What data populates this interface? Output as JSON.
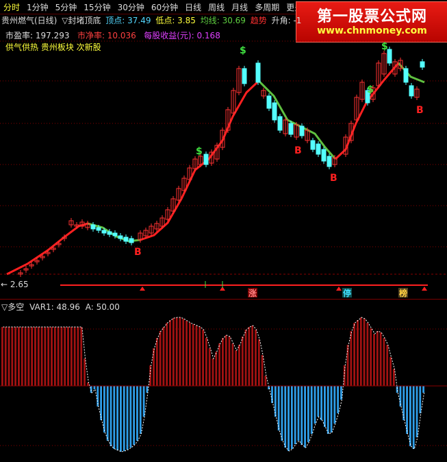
{
  "toolbar": {
    "periods": [
      "分时",
      "1分钟",
      "5分钟",
      "15分钟",
      "30分钟",
      "60分钟",
      "日线",
      "周线",
      "月线",
      "多周期",
      "更多"
    ],
    "active_index": 0
  },
  "logo": {
    "main": "第一股票公式网",
    "sub": "www.chnmoney.com"
  },
  "info": {
    "stock": "贵州燃气(日线)",
    "formula": "▽封堵顶底",
    "high_label": "顶点: 37.49",
    "low_label": "低点: 3.85",
    "avg_label": "均线: 30.69",
    "trend_label": "趋势",
    "angle_label": "升角: -1"
  },
  "fundamentals": {
    "pe": "市盈率:  197.293",
    "pb": "市净率:  10.036",
    "eps": "每股收益(元):  0.168"
  },
  "tags": "供气供热 贵州板块 次新股",
  "price_low_marker": "2.65",
  "markers": {
    "buy": "$",
    "sell": "B",
    "limit_up": "涨",
    "halt": "停",
    "list": "榜"
  },
  "lower_panel": {
    "title": "▽多空",
    "var1": "VAR1: 48.96",
    "a_val": "A: 50.00"
  },
  "colors": {
    "up_candle": "#ff3232",
    "down_candle": "#54ffff",
    "trend_up": "#ff2020",
    "trend_down": "#5fc040",
    "bull_bar": "#a31212",
    "bear_bar": "#2f9ee8",
    "accent": "#ffff3b"
  },
  "chart_data": {
    "type": "bar",
    "title": "",
    "bull_bear_values": [
      86,
      86,
      86,
      86,
      86,
      86,
      86,
      86,
      86,
      86,
      86,
      86,
      86,
      86,
      86,
      86,
      86,
      86,
      86,
      86,
      86,
      86,
      86,
      86,
      86,
      40,
      5,
      -10,
      -5,
      -30,
      -50,
      -68,
      -80,
      -88,
      -92,
      -94,
      -96,
      -95,
      -93,
      -90,
      -86,
      -80,
      -70,
      -45,
      -10,
      30,
      55,
      70,
      80,
      86,
      92,
      96,
      99,
      100,
      100,
      98,
      95,
      92,
      90,
      88,
      86,
      82,
      70,
      55,
      40,
      50,
      62,
      70,
      74,
      72,
      62,
      52,
      60,
      72,
      82,
      86,
      88,
      82,
      68,
      45,
      15,
      -5,
      -25,
      -45,
      -65,
      -80,
      -90,
      -95,
      -92,
      -85,
      -80,
      -86,
      -90,
      -82,
      -70,
      -55,
      -45,
      -50,
      -60,
      -70,
      -68,
      -55,
      -40,
      -20,
      30,
      60,
      80,
      92,
      96,
      100,
      98,
      92,
      84,
      76,
      80,
      78,
      70,
      60,
      42,
      25,
      -10,
      -30,
      -50,
      -70,
      -88,
      -92,
      -75,
      -40,
      -10
    ],
    "ylim": [
      -100,
      100
    ]
  }
}
